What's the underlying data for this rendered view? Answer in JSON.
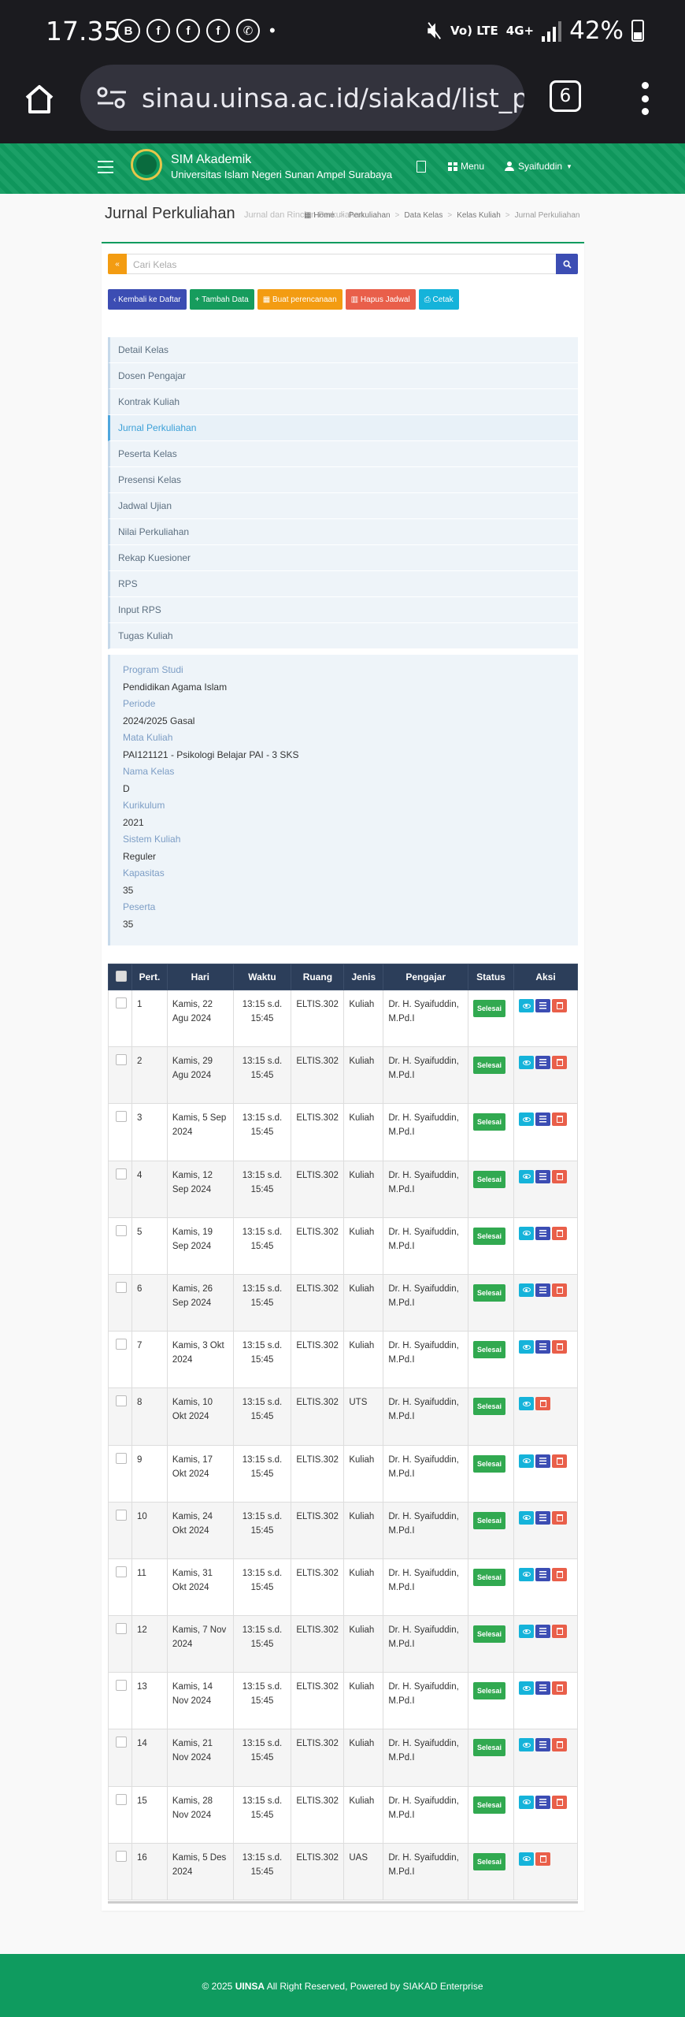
{
  "status_bar": {
    "time": "17.35",
    "app_icons": [
      "B",
      "f",
      "f",
      "f",
      "wa"
    ],
    "network": "Vo) LTE",
    "data": "4G+",
    "battery": "42%"
  },
  "browser": {
    "url": "sinau.uinsa.ac.id/siakad/list_per",
    "tab_count": "6"
  },
  "navbar": {
    "app_name": "SIM Akademik",
    "university": "Universitas Islam Negeri Sunan Ampel Surabaya",
    "menu_label": "Menu",
    "user": "Syaifuddin"
  },
  "page": {
    "title": "Jurnal Perkuliahan",
    "subtitle": "Jurnal dan Rincian Perkuliahan"
  },
  "breadcrumb": [
    "Home",
    "Perkuliahan",
    "Data Kelas",
    "Kelas Kuliah",
    "Jurnal Perkuliahan"
  ],
  "search": {
    "placeholder": "Cari Kelas"
  },
  "actions": {
    "back": "Kembali ke Daftar",
    "add": "Tambah Data",
    "plan": "Buat perencanaan",
    "delete_schedule": "Hapus Jadwal",
    "print": "Cetak"
  },
  "colors": {
    "green": "#0f9b5f",
    "blue": "#3c4db3",
    "orange": "#f39c12",
    "red": "#e95f4a",
    "cyan": "#15b3da",
    "header": "#2c3e5a"
  },
  "side_menu": [
    "Detail Kelas",
    "Dosen Pengajar",
    "Kontrak Kuliah",
    "Jurnal Perkuliahan",
    "Peserta Kelas",
    "Presensi Kelas",
    "Jadwal Ujian",
    "Nilai Perkuliahan",
    "Rekap Kuesioner",
    "RPS",
    "Input RPS",
    "Tugas Kuliah"
  ],
  "info": [
    {
      "label": "Program Studi",
      "value": "Pendidikan Agama Islam"
    },
    {
      "label": "Periode",
      "value": "2024/2025 Gasal"
    },
    {
      "label": "Mata Kuliah",
      "value": "PAI121121 - Psikologi Belajar PAI - 3 SKS"
    },
    {
      "label": "Nama Kelas",
      "value": "D"
    },
    {
      "label": "Kurikulum",
      "value": "2021"
    },
    {
      "label": "Sistem Kuliah",
      "value": "Reguler"
    },
    {
      "label": "Kapasitas",
      "value": "35"
    },
    {
      "label": "Peserta",
      "value": "35"
    }
  ],
  "table": {
    "headers": [
      "Pert.",
      "Hari",
      "Waktu",
      "Ruang",
      "Jenis",
      "Pengajar",
      "Status",
      "Aksi"
    ],
    "rows": [
      {
        "no": "1",
        "hari": "Kamis, 22 Agu 2024",
        "waktu": "13:15 s.d. 15:45",
        "ruang": "ELTIS.302",
        "jenis": "Kuliah",
        "pengajar": "Dr. H. Syaifuddin, M.Pd.I",
        "status": "Selesai",
        "edit": true
      },
      {
        "no": "2",
        "hari": "Kamis, 29 Agu 2024",
        "waktu": "13:15 s.d. 15:45",
        "ruang": "ELTIS.302",
        "jenis": "Kuliah",
        "pengajar": "Dr. H. Syaifuddin, M.Pd.I",
        "status": "Selesai",
        "edit": true
      },
      {
        "no": "3",
        "hari": "Kamis, 5 Sep 2024",
        "waktu": "13:15 s.d. 15:45",
        "ruang": "ELTIS.302",
        "jenis": "Kuliah",
        "pengajar": "Dr. H. Syaifuddin, M.Pd.I",
        "status": "Selesai",
        "edit": true
      },
      {
        "no": "4",
        "hari": "Kamis, 12 Sep 2024",
        "waktu": "13:15 s.d. 15:45",
        "ruang": "ELTIS.302",
        "jenis": "Kuliah",
        "pengajar": "Dr. H. Syaifuddin, M.Pd.I",
        "status": "Selesai",
        "edit": true
      },
      {
        "no": "5",
        "hari": "Kamis, 19 Sep 2024",
        "waktu": "13:15 s.d. 15:45",
        "ruang": "ELTIS.302",
        "jenis": "Kuliah",
        "pengajar": "Dr. H. Syaifuddin, M.Pd.I",
        "status": "Selesai",
        "edit": true
      },
      {
        "no": "6",
        "hari": "Kamis, 26 Sep 2024",
        "waktu": "13:15 s.d. 15:45",
        "ruang": "ELTIS.302",
        "jenis": "Kuliah",
        "pengajar": "Dr. H. Syaifuddin, M.Pd.I",
        "status": "Selesai",
        "edit": true
      },
      {
        "no": "7",
        "hari": "Kamis, 3 Okt 2024",
        "waktu": "13:15 s.d. 15:45",
        "ruang": "ELTIS.302",
        "jenis": "Kuliah",
        "pengajar": "Dr. H. Syaifuddin, M.Pd.I",
        "status": "Selesai",
        "edit": true
      },
      {
        "no": "8",
        "hari": "Kamis, 10 Okt 2024",
        "waktu": "13:15 s.d. 15:45",
        "ruang": "ELTIS.302",
        "jenis": "UTS",
        "pengajar": "Dr. H. Syaifuddin, M.Pd.I",
        "status": "Selesai",
        "edit": false
      },
      {
        "no": "9",
        "hari": "Kamis, 17 Okt 2024",
        "waktu": "13:15 s.d. 15:45",
        "ruang": "ELTIS.302",
        "jenis": "Kuliah",
        "pengajar": "Dr. H. Syaifuddin, M.Pd.I",
        "status": "Selesai",
        "edit": true
      },
      {
        "no": "10",
        "hari": "Kamis, 24 Okt 2024",
        "waktu": "13:15 s.d. 15:45",
        "ruang": "ELTIS.302",
        "jenis": "Kuliah",
        "pengajar": "Dr. H. Syaifuddin, M.Pd.I",
        "status": "Selesai",
        "edit": true
      },
      {
        "no": "11",
        "hari": "Kamis, 31 Okt 2024",
        "waktu": "13:15 s.d. 15:45",
        "ruang": "ELTIS.302",
        "jenis": "Kuliah",
        "pengajar": "Dr. H. Syaifuddin, M.Pd.I",
        "status": "Selesai",
        "edit": true
      },
      {
        "no": "12",
        "hari": "Kamis, 7 Nov 2024",
        "waktu": "13:15 s.d. 15:45",
        "ruang": "ELTIS.302",
        "jenis": "Kuliah",
        "pengajar": "Dr. H. Syaifuddin, M.Pd.I",
        "status": "Selesai",
        "edit": true
      },
      {
        "no": "13",
        "hari": "Kamis, 14 Nov 2024",
        "waktu": "13:15 s.d. 15:45",
        "ruang": "ELTIS.302",
        "jenis": "Kuliah",
        "pengajar": "Dr. H. Syaifuddin, M.Pd.I",
        "status": "Selesai",
        "edit": true
      },
      {
        "no": "14",
        "hari": "Kamis, 21 Nov 2024",
        "waktu": "13:15 s.d. 15:45",
        "ruang": "ELTIS.302",
        "jenis": "Kuliah",
        "pengajar": "Dr. H. Syaifuddin, M.Pd.I",
        "status": "Selesai",
        "edit": true
      },
      {
        "no": "15",
        "hari": "Kamis, 28 Nov 2024",
        "waktu": "13:15 s.d. 15:45",
        "ruang": "ELTIS.302",
        "jenis": "Kuliah",
        "pengajar": "Dr. H. Syaifuddin, M.Pd.I",
        "status": "Selesai",
        "edit": true
      },
      {
        "no": "16",
        "hari": "Kamis, 5 Des 2024",
        "waktu": "13:15 s.d. 15:45",
        "ruang": "ELTIS.302",
        "jenis": "UAS",
        "pengajar": "Dr. H. Syaifuddin, M.Pd.I",
        "status": "Selesai",
        "edit": false
      }
    ]
  },
  "footer": {
    "prefix": "© 2025",
    "brand": "UINSA",
    "suffix": "All Right Reserved, Powered by SIAKAD Enterprise"
  }
}
